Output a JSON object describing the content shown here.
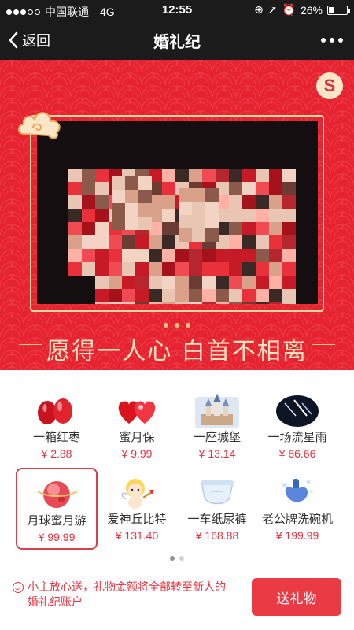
{
  "status_bar": {
    "carrier": "中国联通",
    "network": "4G",
    "time": "12:55",
    "battery": "26%",
    "battery_level": 0.26
  },
  "nav": {
    "back_label": "返回",
    "title": "婚礼纪"
  },
  "hero": {
    "slogan": "愿得一人心 白首不相离",
    "badge_glyph": "S"
  },
  "gifts": [
    {
      "name": "一箱红枣",
      "price": "¥ 2.88",
      "icon": "red-dates-icon"
    },
    {
      "name": "蜜月保",
      "price": "¥ 9.99",
      "icon": "hearts-icon"
    },
    {
      "name": "一座城堡",
      "price": "¥ 13.14",
      "icon": "castle-icon"
    },
    {
      "name": "一场流星雨",
      "price": "¥ 66.66",
      "icon": "meteor-shower-icon"
    },
    {
      "name": "月球蜜月游",
      "price": "¥ 99.99",
      "icon": "moon-icon",
      "selected": true
    },
    {
      "name": "爱神丘比特",
      "price": "¥ 131.40",
      "icon": "cupid-icon"
    },
    {
      "name": "一车纸尿裤",
      "price": "¥ 168.88",
      "icon": "diaper-icon"
    },
    {
      "name": "老公牌洗碗机",
      "price": "¥ 199.99",
      "icon": "dishwasher-icon"
    }
  ],
  "pager": {
    "pages": 2,
    "current": 1
  },
  "footer": {
    "note": "小主放心送，礼物金额将全部转至新人的婚礼纪账户",
    "send_label": "送礼物"
  },
  "colors": {
    "accent": "#e8323e",
    "hero_red": "#e62431",
    "gold": "#f6d7a0",
    "dark_bar": "#1b1b1b"
  }
}
